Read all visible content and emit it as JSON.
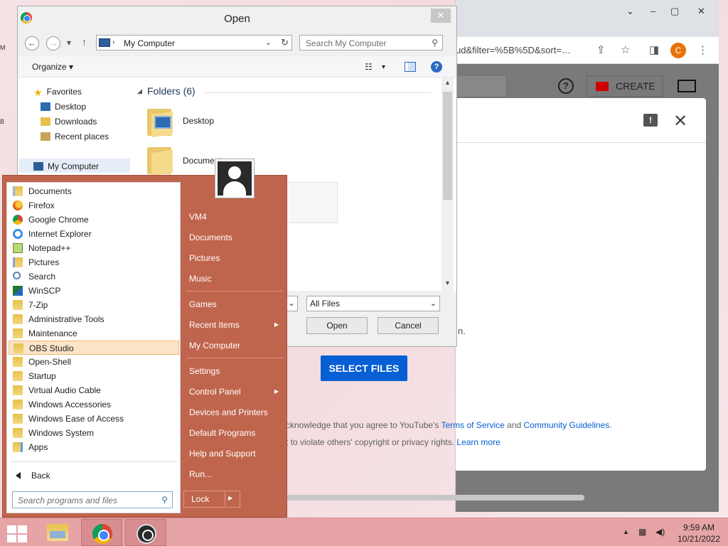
{
  "open_dialog": {
    "title": "Open",
    "close_glyph": "✕",
    "address": "My Computer",
    "search_placeholder": "Search My Computer",
    "organize_label": "Organize",
    "nav_pane": {
      "favorites_label": "Favorites",
      "items": [
        "Desktop",
        "Downloads",
        "Recent places"
      ],
      "computer_label": "My Computer"
    },
    "folders_heading": "Folders (6)",
    "folders": [
      "Desktop",
      "Documents"
    ],
    "file_type": "All Files",
    "open_label": "Open",
    "cancel_label": "Cancel"
  },
  "start_menu": {
    "programs": [
      {
        "label": "Documents",
        "icon": "docs-icon"
      },
      {
        "label": "Firefox",
        "icon": "firefox-icon"
      },
      {
        "label": "Google Chrome",
        "icon": "chrome-icon"
      },
      {
        "label": "Internet Explorer",
        "icon": "ie-icon"
      },
      {
        "label": "Notepad++",
        "icon": "notepad-icon"
      },
      {
        "label": "Pictures",
        "icon": "pictures-icon"
      },
      {
        "label": "Search",
        "icon": "search-icon"
      },
      {
        "label": "WinSCP",
        "icon": "winscp-icon"
      },
      {
        "label": "7-Zip",
        "icon": "folder-icon"
      },
      {
        "label": "Administrative Tools",
        "icon": "folder-icon"
      },
      {
        "label": "Maintenance",
        "icon": "folder-icon"
      },
      {
        "label": "OBS Studio",
        "icon": "folder-icon",
        "selected": true
      },
      {
        "label": "Open-Shell",
        "icon": "folder-icon"
      },
      {
        "label": "Startup",
        "icon": "folder-icon"
      },
      {
        "label": "Virtual Audio Cable",
        "icon": "folder-icon"
      },
      {
        "label": "Windows Accessories",
        "icon": "folder-icon"
      },
      {
        "label": "Windows Ease of Access",
        "icon": "folder-icon"
      },
      {
        "label": "Windows System",
        "icon": "folder-icon"
      },
      {
        "label": "Apps",
        "icon": "apps-icon"
      }
    ],
    "back_label": "Back",
    "search_placeholder": "Search programs and files",
    "right_items": [
      {
        "label": "VM4"
      },
      {
        "label": "Documents"
      },
      {
        "label": "Pictures"
      },
      {
        "label": "Music"
      },
      {
        "label": "Games"
      },
      {
        "label": "Recent Items",
        "submenu": true
      },
      {
        "label": "My Computer"
      },
      {
        "label": "Settings"
      },
      {
        "label": "Control Panel",
        "submenu": true
      },
      {
        "label": "Devices and Printers"
      },
      {
        "label": "Default Programs"
      },
      {
        "label": "Help and Support"
      },
      {
        "label": "Run..."
      }
    ],
    "lock_label": "Lock",
    "accent_color": "#c0654d"
  },
  "browser": {
    "url_fragment": "ud&filter=%5B%5D&sort=…",
    "profile_initial": "C",
    "create_label": "CREATE",
    "help_glyph": "?",
    "select_files_label": "SELECT FILES",
    "dialog_fragment": "n.",
    "legal_line1_prefix": "cknowledge that you agree to YouTube's ",
    "terms_link": "Terms of Service",
    "legal_and": " and ",
    "guidelines_link": "Community Guidelines",
    "legal_line1_suffix": ".",
    "legal_line2_prefix": "t to violate others' copyright or privacy rights. ",
    "learn_more_link": "Learn more",
    "accent_color": "#065fd4"
  },
  "taskbar": {
    "time": "9:59 AM",
    "date": "10/21/2022",
    "apps": [
      "file-explorer-icon",
      "chrome-icon",
      "obs-icon"
    ]
  }
}
